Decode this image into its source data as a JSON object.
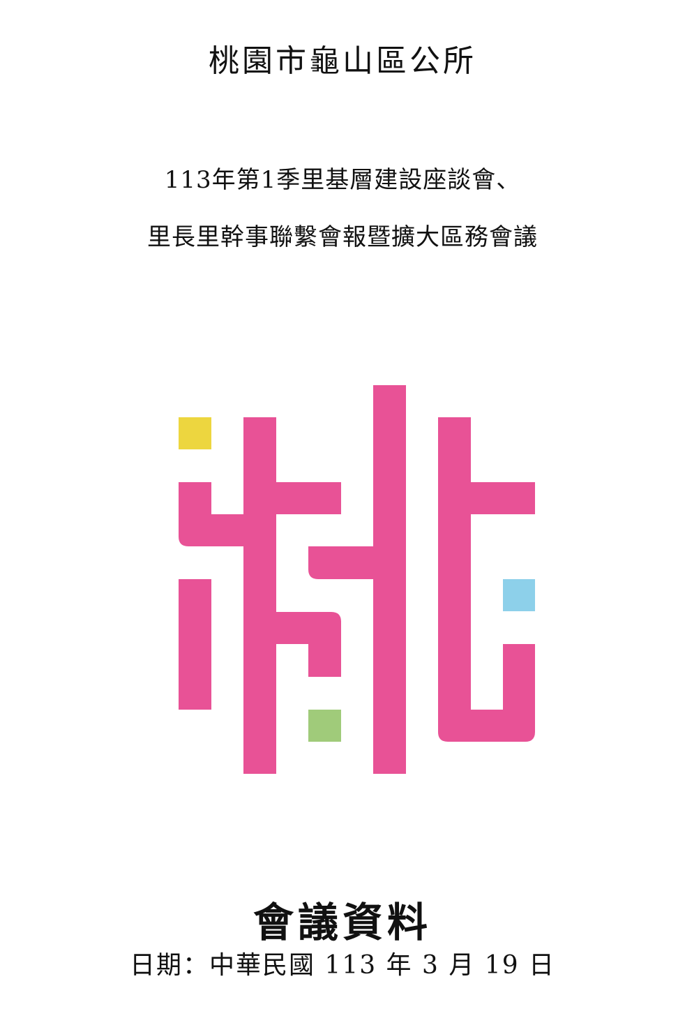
{
  "cover": {
    "organization": "桃園市龜山區公所",
    "meeting_title_line1": "113年第1季里基層建設座談會、",
    "meeting_title_line2": "里長里幹事聯繫會報暨擴大區務會議",
    "document_label": "會議資料",
    "date_line": "日期：中華民國 113 年 3 月 19 日"
  },
  "logo": {
    "name": "taoyuan-logo",
    "colors": {
      "primary": "#E85296",
      "yellow": "#EDD63F",
      "blue": "#8DD0EA",
      "green": "#A0CB7A"
    }
  }
}
